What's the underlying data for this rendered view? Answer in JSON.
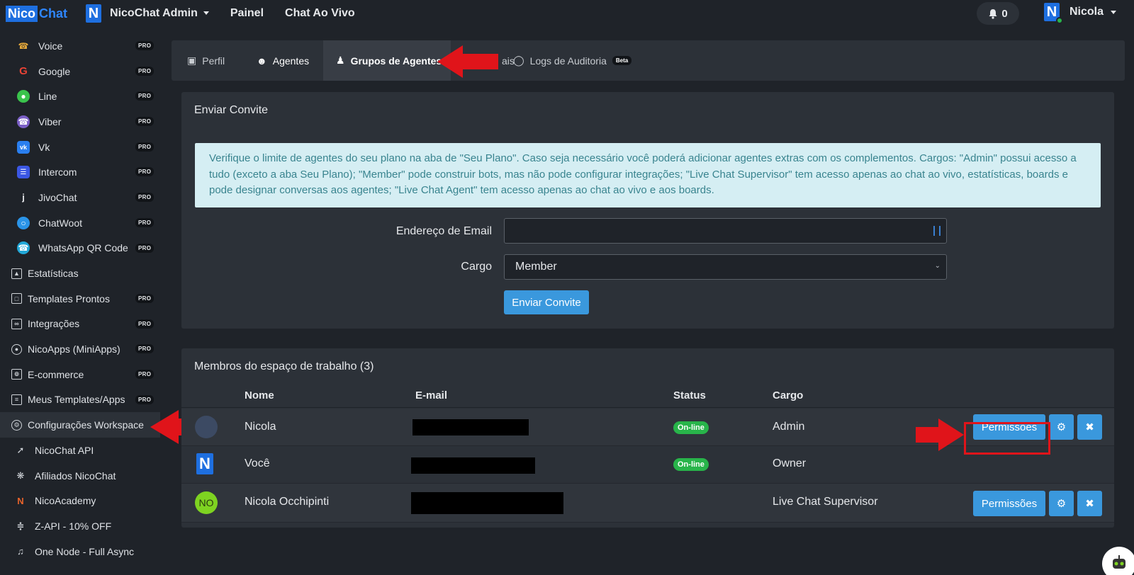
{
  "topbar": {
    "logo_part1": "Nico",
    "logo_part2": "Chat",
    "workspace_badge": "N",
    "workspace_name": "NicoChat Admin",
    "nav": [
      "Painel",
      "Chat Ao Vivo"
    ],
    "notifications_count": "0",
    "user_badge": "N",
    "user_name": "Nicola"
  },
  "sidebar": {
    "items": [
      {
        "label": "Voice",
        "icon": "voice-icon",
        "pro": "PRO"
      },
      {
        "label": "Google",
        "icon": "google-icon",
        "pro": "PRO"
      },
      {
        "label": "Line",
        "icon": "line-icon",
        "pro": "PRO"
      },
      {
        "label": "Viber",
        "icon": "viber-icon",
        "pro": "PRO"
      },
      {
        "label": "Vk",
        "icon": "vk-icon",
        "pro": "PRO"
      },
      {
        "label": "Intercom",
        "icon": "intercom-icon",
        "pro": "PRO"
      },
      {
        "label": "JivoChat",
        "icon": "jivochat-icon",
        "pro": "PRO"
      },
      {
        "label": "ChatWoot",
        "icon": "chatwoot-icon",
        "pro": "PRO"
      },
      {
        "label": "WhatsApp QR Code",
        "icon": "whatsapp-icon",
        "pro": "PRO"
      },
      {
        "label": "Estatísticas",
        "icon": "stats-icon",
        "pro": ""
      },
      {
        "label": "Templates Prontos",
        "icon": "templates-icon",
        "pro": "PRO"
      },
      {
        "label": "Integrações",
        "icon": "integrations-icon",
        "pro": "PRO"
      },
      {
        "label": "NicoApps (MiniApps)",
        "icon": "user-icon",
        "pro": "PRO"
      },
      {
        "label": "E-commerce",
        "icon": "cart-icon",
        "pro": "PRO"
      },
      {
        "label": "Meus Templates/Apps",
        "icon": "document-icon",
        "pro": "PRO"
      },
      {
        "label": "Configurações Workspace",
        "icon": "gear-icon",
        "pro": ""
      },
      {
        "label": "NicoChat API",
        "icon": "api-icon",
        "pro": ""
      },
      {
        "label": "Afiliados NicoChat",
        "icon": "affiliates-icon",
        "pro": ""
      },
      {
        "label": "NicoAcademy",
        "icon": "academy-icon",
        "pro": ""
      },
      {
        "label": "Z-API - 10% OFF",
        "icon": "zapi-icon",
        "pro": ""
      },
      {
        "label": "One Node - Full Async",
        "icon": "node-icon",
        "pro": ""
      }
    ]
  },
  "tabs": {
    "perfil": "Perfil",
    "agentes": "Agentes",
    "grupos": "Grupos de Agentes",
    "hidden_partial": "ais",
    "logs": "Logs de Auditoria",
    "logs_badge": "Beta"
  },
  "invite": {
    "title": "Enviar Convite",
    "alert": "Verifique o limite de agentes do seu plano na aba de \"Seu Plano\". Caso seja necessário você poderá adicionar agentes extras com os complementos. Cargos: \"Admin\" possui acesso a tudo (exceto a aba Seu Plano); \"Member\" pode construir bots, mas não pode configurar integrações; \"Live Chat Supervisor\" tem acesso apenas ao chat ao vivo, estatísticas, boards e pode designar conversas aos agentes; \"Live Chat Agent\" tem acesso apenas ao chat ao vivo e aos boards.",
    "email_label": "Endereço de Email",
    "email_value": "",
    "role_label": "Cargo",
    "role_value": "Member",
    "submit": "Enviar Convite"
  },
  "members": {
    "title": "Membros do espaço de trabalho (3)",
    "columns": [
      "Nome",
      "E-mail",
      "Status",
      "Cargo"
    ],
    "rows": [
      {
        "name": "Nicola",
        "status": "On-line",
        "role": "Admin",
        "permissions": "Permissões",
        "avatar": ""
      },
      {
        "name": "Você",
        "status": "On-line",
        "role": "Owner",
        "permissions": "",
        "avatar": "N"
      },
      {
        "name": "Nicola Occhipinti",
        "status": "",
        "role": "Live Chat Supervisor",
        "permissions": "Permissões",
        "avatar": "NO"
      }
    ]
  },
  "colors": {
    "background": "#1f2329",
    "panel": "#2c3138",
    "primary_button": "#3a98dd",
    "online_badge": "#28b44a",
    "annotation_red": "#e0141a",
    "alert_bg": "#d5eef3",
    "alert_text": "#39848f",
    "brand_blue": "#1e6fe0"
  }
}
